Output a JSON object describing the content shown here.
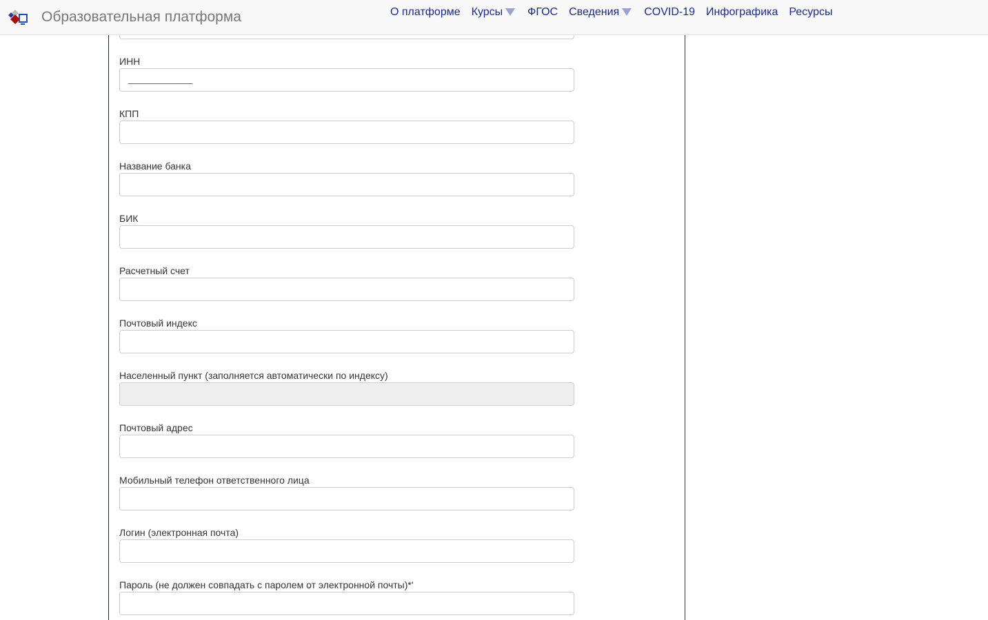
{
  "header": {
    "brand": "Образовательная платформа",
    "nav": [
      {
        "label": "О платформе",
        "dropdown": false
      },
      {
        "label": "Курсы",
        "dropdown": true
      },
      {
        "label": "ФГОС",
        "dropdown": false
      },
      {
        "label": "Сведения",
        "dropdown": true
      },
      {
        "label": "COVID-19",
        "dropdown": false
      },
      {
        "label": "Инфографика",
        "dropdown": false
      },
      {
        "label": "Ресурсы",
        "dropdown": false
      }
    ]
  },
  "form": {
    "fields": [
      {
        "label": "ИНН",
        "value": "____________"
      },
      {
        "label": "КПП",
        "value": ""
      },
      {
        "label": "Название банка",
        "value": ""
      },
      {
        "label": "БИК",
        "value": ""
      },
      {
        "label": "Расчетный счет",
        "value": ""
      },
      {
        "label": "Почтовый индекс",
        "value": ""
      },
      {
        "label": "Населенный пункт (заполняется автоматически по индексу)",
        "value": "",
        "disabled": true
      },
      {
        "label": "Почтовый адрес",
        "value": ""
      },
      {
        "label": "Мобильный телефон ответственного лица",
        "value": ""
      },
      {
        "label": "Логин (электронная почта)",
        "value": ""
      },
      {
        "label": "Пароль (не должен совпадать с паролем от электронной почты)*'",
        "value": ""
      }
    ]
  }
}
